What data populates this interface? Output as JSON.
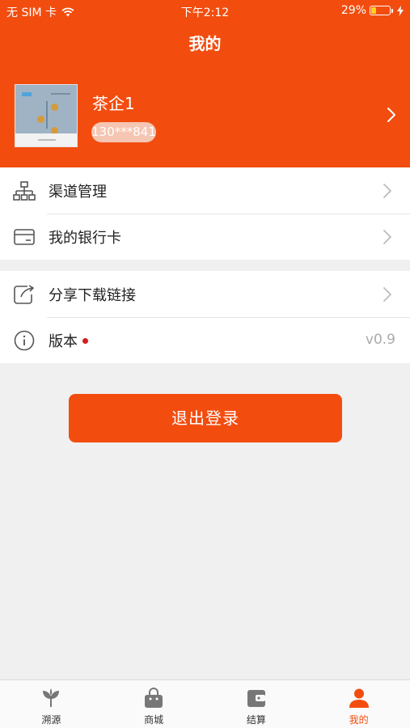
{
  "status_bar": {
    "carrier": "无 SIM 卡",
    "time": "下午2:12",
    "battery_percent_text": "29%",
    "battery_level": 0.29
  },
  "header": {
    "title": "我的"
  },
  "profile": {
    "name": "茶企1",
    "phone": "130***841"
  },
  "menu": {
    "group1": [
      {
        "label": "渠道管理",
        "icon": "org-chart-icon"
      },
      {
        "label": "我的银行卡",
        "icon": "bank-card-icon"
      }
    ],
    "group2": [
      {
        "label": "分享下载链接",
        "icon": "share-icon"
      },
      {
        "label": "版本",
        "icon": "info-icon",
        "value": "v0.9"
      }
    ]
  },
  "logout_button": "退出登录",
  "tabbar": [
    {
      "label": "溯源",
      "icon": "leaf-icon",
      "active": false
    },
    {
      "label": "商城",
      "icon": "shopping-bag-icon",
      "active": false
    },
    {
      "label": "结算",
      "icon": "wallet-icon",
      "active": false
    },
    {
      "label": "我的",
      "icon": "person-icon",
      "active": true
    }
  ],
  "colors": {
    "accent": "#f24d0f",
    "background": "#f0f0f0",
    "version_dot": "#d61a1a"
  }
}
